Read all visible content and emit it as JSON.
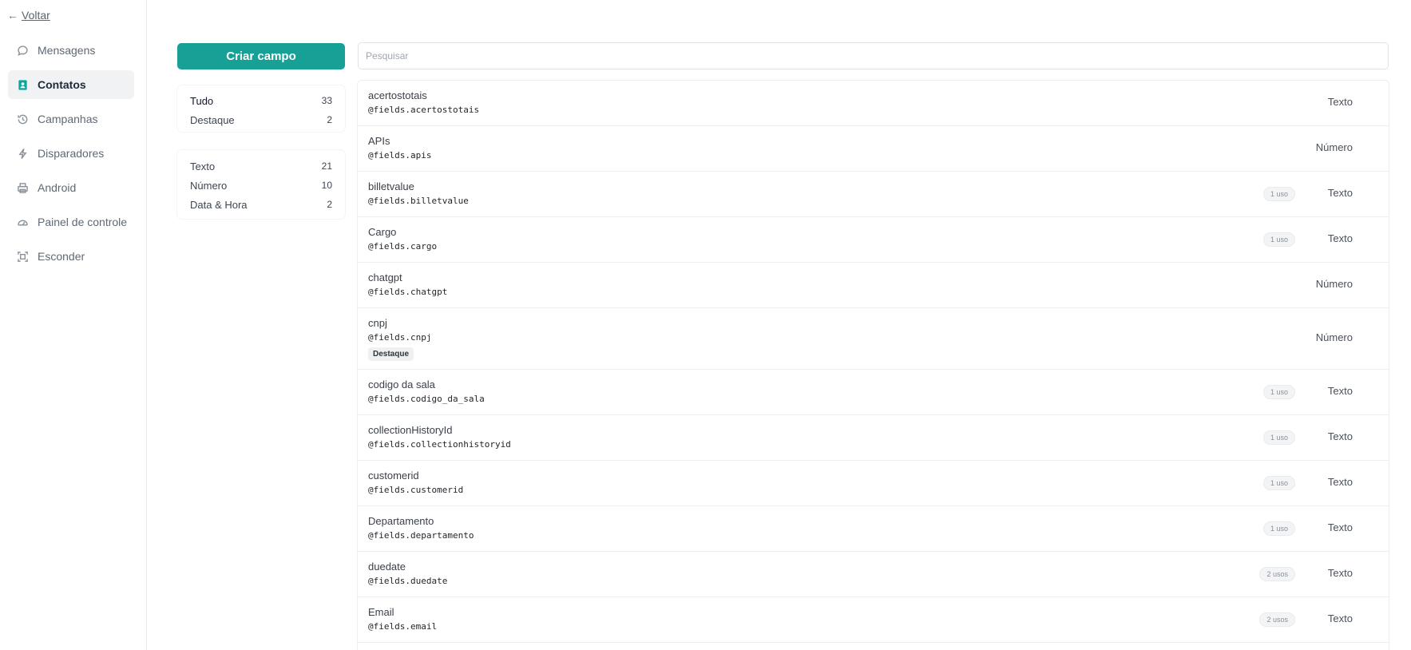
{
  "sidebar": {
    "back_arrow": "←",
    "back_label": "Voltar",
    "items": [
      {
        "label": "Mensagens",
        "icon": "chat-bubble-icon"
      },
      {
        "label": "Contatos",
        "icon": "contact-card-icon",
        "active": true
      },
      {
        "label": "Campanhas",
        "icon": "history-icon"
      },
      {
        "label": "Disparadores",
        "icon": "lightning-icon"
      },
      {
        "label": "Android",
        "icon": "printer-device-icon"
      },
      {
        "label": "Painel de controle",
        "icon": "gauge-icon"
      },
      {
        "label": "Esconder",
        "icon": "collapse-frame-icon"
      }
    ]
  },
  "toolbar": {
    "create_label": "Criar campo",
    "search_placeholder": "Pesquisar"
  },
  "filters": {
    "group1": [
      {
        "label": "Tudo",
        "count": "33"
      },
      {
        "label": "Destaque",
        "count": "2"
      }
    ],
    "group2": [
      {
        "label": "Texto",
        "count": "21"
      },
      {
        "label": "Número",
        "count": "10"
      },
      {
        "label": "Data & Hora",
        "count": "2"
      }
    ]
  },
  "fields": [
    {
      "name": "acertostotais",
      "key": "@fields.acertostotais",
      "uses": "",
      "type": "Texto",
      "tag": ""
    },
    {
      "name": "APIs",
      "key": "@fields.apis",
      "uses": "",
      "type": "Número",
      "tag": ""
    },
    {
      "name": "billetvalue",
      "key": "@fields.billetvalue",
      "uses": "1 uso",
      "type": "Texto",
      "tag": ""
    },
    {
      "name": "Cargo",
      "key": "@fields.cargo",
      "uses": "1 uso",
      "type": "Texto",
      "tag": ""
    },
    {
      "name": "chatgpt",
      "key": "@fields.chatgpt",
      "uses": "",
      "type": "Número",
      "tag": ""
    },
    {
      "name": "cnpj",
      "key": "@fields.cnpj",
      "uses": "",
      "type": "Número",
      "tag": "Destaque"
    },
    {
      "name": "codigo da sala",
      "key": "@fields.codigo_da_sala",
      "uses": "1 uso",
      "type": "Texto",
      "tag": ""
    },
    {
      "name": "collectionHistoryId",
      "key": "@fields.collectionhistoryid",
      "uses": "1 uso",
      "type": "Texto",
      "tag": ""
    },
    {
      "name": "customerid",
      "key": "@fields.customerid",
      "uses": "1 uso",
      "type": "Texto",
      "tag": ""
    },
    {
      "name": "Departamento",
      "key": "@fields.departamento",
      "uses": "1 uso",
      "type": "Texto",
      "tag": ""
    },
    {
      "name": "duedate",
      "key": "@fields.duedate",
      "uses": "2 usos",
      "type": "Texto",
      "tag": ""
    },
    {
      "name": "Email",
      "key": "@fields.email",
      "uses": "2 usos",
      "type": "Texto",
      "tag": ""
    }
  ]
}
